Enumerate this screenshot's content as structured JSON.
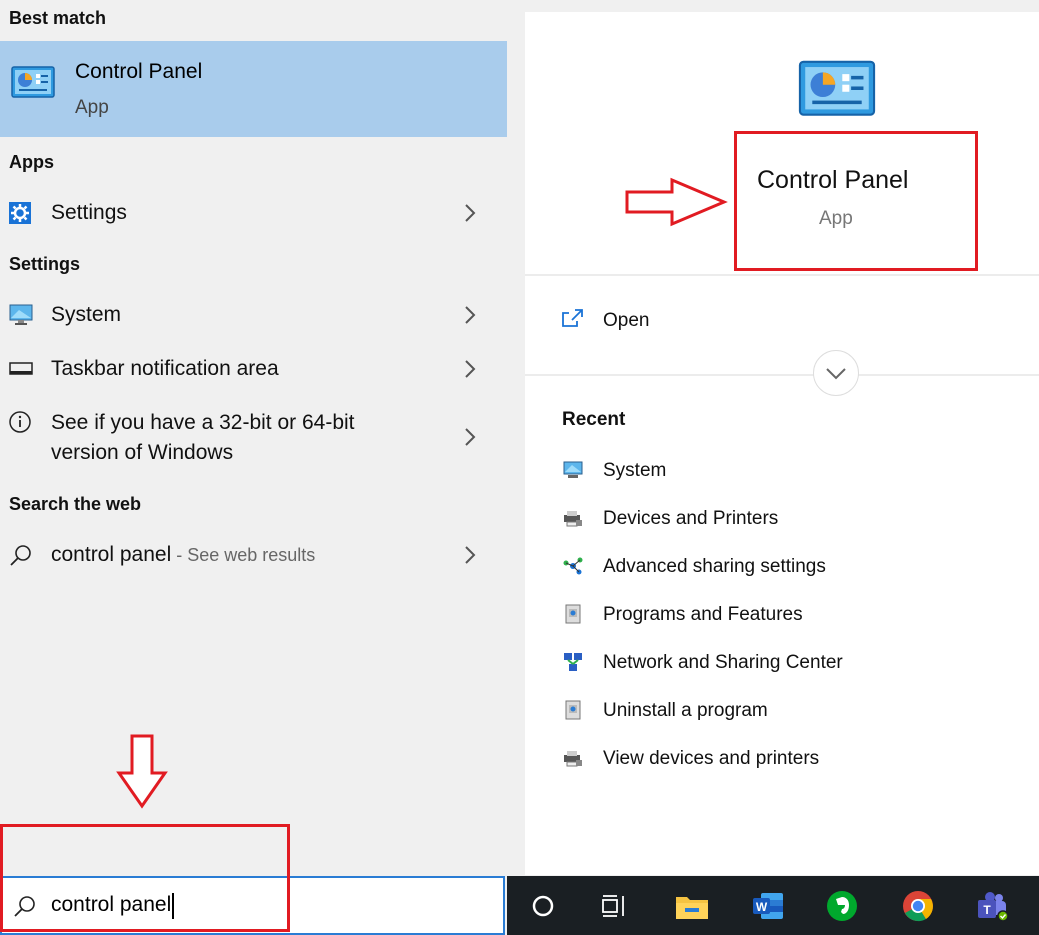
{
  "left": {
    "best_match_header": "Best match",
    "best_match": {
      "title": "Control Panel",
      "subtitle": "App",
      "icon": "control-panel-icon"
    },
    "apps_header": "Apps",
    "apps": [
      {
        "label": "Settings",
        "icon": "gear-icon"
      }
    ],
    "settings_header": "Settings",
    "settings": [
      {
        "label": "System",
        "icon": "monitor-icon"
      },
      {
        "label": "Taskbar notification area",
        "icon": "taskbar-icon"
      },
      {
        "label_line1": "See if you have a 32-bit or 64-bit",
        "label_line2": "version of Windows",
        "icon": "info-icon"
      }
    ],
    "web_header": "Search the web",
    "web": {
      "query": "control panel",
      "suffix": " - See web results",
      "icon": "search-icon"
    }
  },
  "search": {
    "value": "control panel"
  },
  "right": {
    "app_title": "Control Panel",
    "app_subtitle": "App",
    "open_label": "Open",
    "recent_header": "Recent",
    "recent": [
      {
        "label": "System",
        "icon": "system-icon"
      },
      {
        "label": "Devices and Printers",
        "icon": "printer-icon"
      },
      {
        "label": "Advanced sharing settings",
        "icon": "network-sharing-icon"
      },
      {
        "label": "Programs and Features",
        "icon": "programs-icon"
      },
      {
        "label": "Network and Sharing Center",
        "icon": "network-center-icon"
      },
      {
        "label": "Uninstall a program",
        "icon": "programs-icon"
      },
      {
        "label": "View devices and printers",
        "icon": "printer-icon"
      }
    ]
  },
  "taskbar": {
    "items": [
      "cortana-icon",
      "task-view-icon",
      "file-explorer-icon",
      "word-icon",
      "evernote-icon",
      "chrome-icon",
      "teams-icon"
    ]
  },
  "colors": {
    "selection": "#a9ccec",
    "accent": "#2a7cd4",
    "annotation": "#e11b22",
    "taskbar": "#1a1f23"
  }
}
